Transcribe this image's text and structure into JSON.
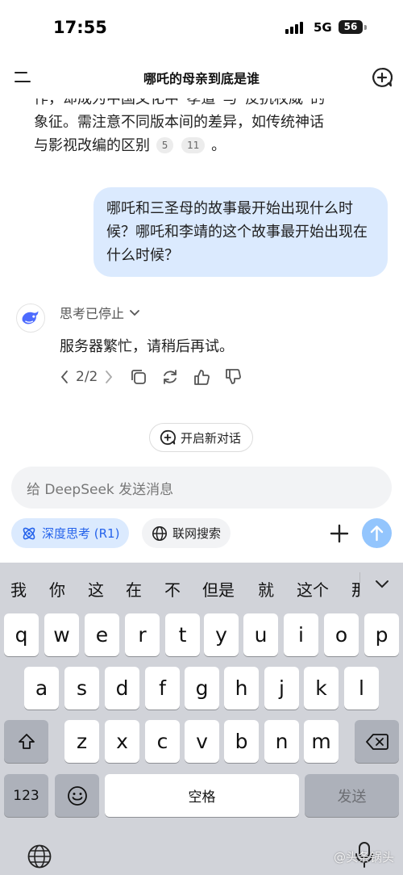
{
  "status_bar": {
    "time": "17:55",
    "network": "5G",
    "battery": "56"
  },
  "header": {
    "title": "哪吒的母亲到底是谁",
    "menu_icon": "menu-icon",
    "new_chat_icon": "new-chat-icon"
  },
  "chat": {
    "partial_lines": [
      "作，却成为中国文化中“孝道”与“反抗权威”的",
      "象征。需注意不同版本间的差异，如传统神话",
      "与影视改编的区别"
    ],
    "citations": [
      "5",
      "11"
    ],
    "partial_tail": "。",
    "user_message": "哪吒和三圣母的故事最开始出现什么时候？哪吒和李靖的这个故事最开始出现在什么时候？",
    "assistant": {
      "thinking_label": "思考已停止",
      "reply": "服务器繁忙，请稍后再试。",
      "pager": "2/2"
    },
    "new_topic": "开启新对话"
  },
  "composer": {
    "placeholder": "给 DeepSeek 发送消息",
    "deep_think": "深度思考 (R1)",
    "web_search": "联网搜索",
    "accent": "#2563eb",
    "send_color": "#93c5fd"
  },
  "keyboard": {
    "candidates": [
      "我",
      "你",
      "这",
      "在",
      "不",
      "但是",
      "就",
      "这个",
      "那"
    ],
    "row1": [
      "q",
      "w",
      "e",
      "r",
      "t",
      "y",
      "u",
      "i",
      "o",
      "p"
    ],
    "row2": [
      "a",
      "s",
      "d",
      "f",
      "g",
      "h",
      "j",
      "k",
      "l"
    ],
    "row3": [
      "z",
      "x",
      "c",
      "v",
      "b",
      "n",
      "m"
    ],
    "num_key": "123",
    "space": "空格",
    "send": "发送",
    "watermark": "@头条锅头"
  }
}
